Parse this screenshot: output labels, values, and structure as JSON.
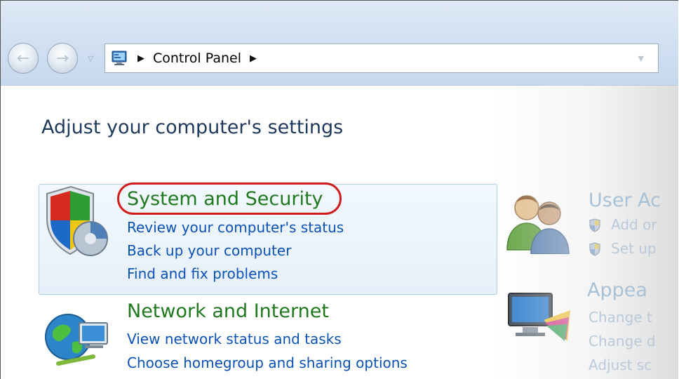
{
  "navigation": {
    "back_glyph": "←",
    "forward_glyph": "→",
    "history_glyph": "▽",
    "arrow_glyph": "▶",
    "dropdown_glyph": "▼"
  },
  "address_bar": {
    "breadcrumbs": [
      "Control Panel"
    ]
  },
  "page": {
    "title": "Adjust your computer's settings"
  },
  "categories": {
    "system_security": {
      "heading": "System and Security",
      "links": [
        "Review your computer's status",
        "Back up your computer",
        "Find and fix problems"
      ],
      "icon": "shield-icon",
      "highlighted": true,
      "highlight_color": "#d11c1c"
    },
    "network_internet": {
      "heading": "Network and Internet",
      "links": [
        "View network status and tasks",
        "Choose homegroup and sharing options"
      ],
      "icon": "network-globe-icon"
    },
    "user_accounts": {
      "heading": "User Ac",
      "links": [
        "Add or",
        "Set up"
      ],
      "icon": "users-icon"
    },
    "appearance": {
      "heading": "Appea",
      "links": [
        "Change t",
        "Change d",
        "Adjust sc"
      ],
      "icon": "monitor-palette-icon"
    }
  },
  "colors": {
    "heading_green": "#1f7a1f",
    "link_blue": "#0a52b8",
    "title_navy": "#1e395b",
    "panel_border": "#a9cdee"
  }
}
